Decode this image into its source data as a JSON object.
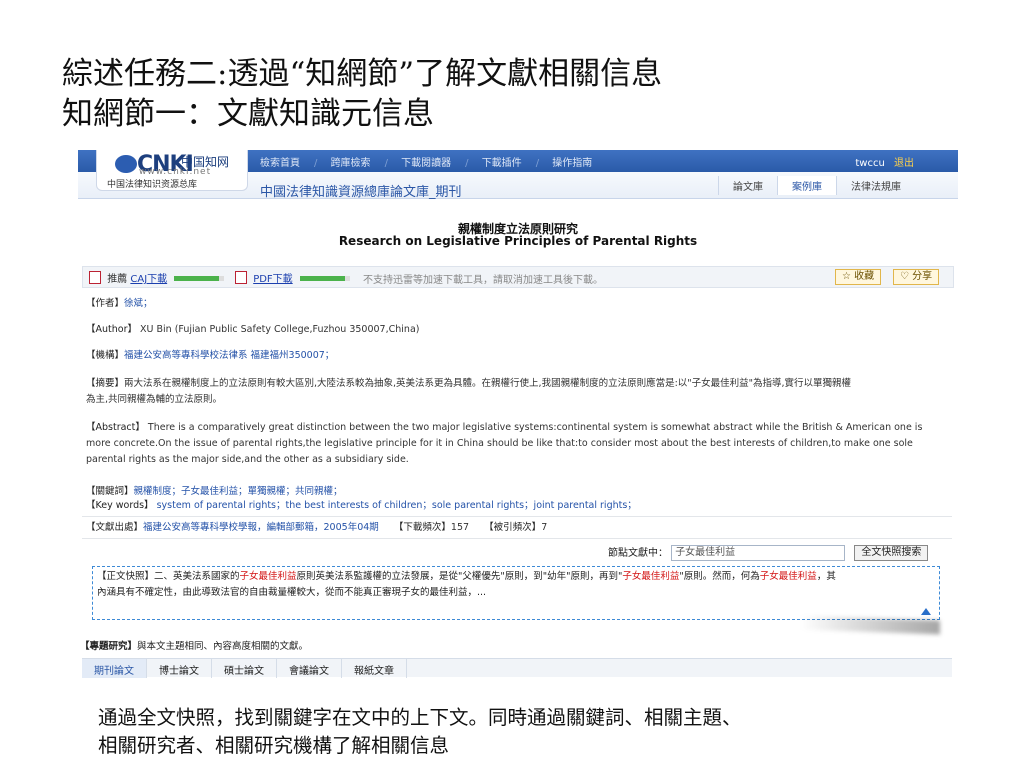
{
  "slide": {
    "title_line1": "綜述任務二:透過“知網節”了解文獻相關信息",
    "title_line2": "知網節一：文獻知識元信息",
    "caption_line1": "通過全文快照，找到關鍵字在文中的上下文。同時通過關鍵詞、相關主題、",
    "caption_line2": "相關研究者、相關研究機構了解相關信息"
  },
  "cnki": {
    "logo_mark": "CNKI",
    "logo_cn": "中国知网",
    "logo_url": "www.cnki.net",
    "logo_sub": "中国法律知识资源总库",
    "nav": [
      "檢索首頁",
      "跨庫檢索",
      "下載閱讀器",
      "下載插件",
      "操作指南"
    ],
    "user": "twccu",
    "logout": "退出",
    "db_title": "中國法律知識資源總庫論文庫_期刊",
    "tabs": [
      "論文庫",
      "案例庫",
      "法律法規庫"
    ],
    "active_tab": "案例庫"
  },
  "article": {
    "title_cn": "親權制度立法原則研究",
    "title_en": "Research on Legislative Principles of Parental Rights",
    "caj_prefix": "推薦",
    "caj_label": "CAJ下載",
    "pdf_label": "PDF下載",
    "progress": 0.9,
    "notice": "不支持迅雷等加速下載工具，請取消加速工具後下載。",
    "favorite": "收藏",
    "share": "分享",
    "author_label": "【作者】",
    "author_value": "徐斌；",
    "author_en_label": "【Author】",
    "author_en_value": "XU Bin (Fujian Public Safety College,Fuzhou 350007,China)",
    "org_label": "【機構】",
    "org_value": "福建公安高等專科學校法律系 福建福州350007；",
    "abstract_label": "【摘要】",
    "abstract_line1": "兩大法系在親權制度上的立法原則有較大區別,大陸法系較為抽象,英美法系更為具體。在親權行使上,我國親權制度的立法原則應當是:以\"子女最佳利益\"為指導,實行以單獨親權",
    "abstract_line2": "為主,共同親權為輔的立法原則。",
    "abstract_en_label": "【Abstract】",
    "abstract_en_line1": "There is a comparatively great distinction between the two major legislative systems:continental system is somewhat abstract while the British & American one is",
    "abstract_en_line2": "more concrete.On the issue of parental rights,the legislative principle for it in China should be like that:to consider most about the best interests of children,to make one sole",
    "abstract_en_line3": "parental rights as the major side,and the other as a subsidiary side.",
    "keywords_label": "【關鍵詞】",
    "keywords": "親權制度；子女最佳利益；單獨親權；共同親權；",
    "keywords_en_label": "【Key words】",
    "keywords_en": "system of parental rights；the best interests of children；sole parental rights；joint parental rights；",
    "source_label": "【文獻出處】",
    "source_value": "福建公安高等專科學校學報，編輯部郵箱，2005年04期",
    "downloads_label": "【下載頻次】",
    "downloads_value": "157",
    "cites_label": "【被引頻次】",
    "cites_value": "7",
    "snap_label": "節點文獻中：",
    "snap_input": "子女最佳利益",
    "snap_button": "全文快照搜索",
    "snap_tag": "【正文快照】",
    "snap_text_a": "二、英美法系國家的",
    "snap_hl": "子女最佳利益",
    "snap_text_b": "原則英美法系監護權的立法發展，是從\"父權優先\"原則，到\"幼年\"原則，再到\"",
    "snap_text_c": "\"原則。然而，何為",
    "snap_text_d": "，其",
    "snap_line2": "內涵具有不確定性，由此導致法官的自由裁量權較大，從而不能真正審現子女的最佳利益，...",
    "research_label": "【專題研究】",
    "research_desc": "與本文主題相同、內容高度相關的文獻。",
    "subtabs": [
      "期刊論文",
      "博士論文",
      "碩士論文",
      "會議論文",
      "報紙文章"
    ]
  }
}
